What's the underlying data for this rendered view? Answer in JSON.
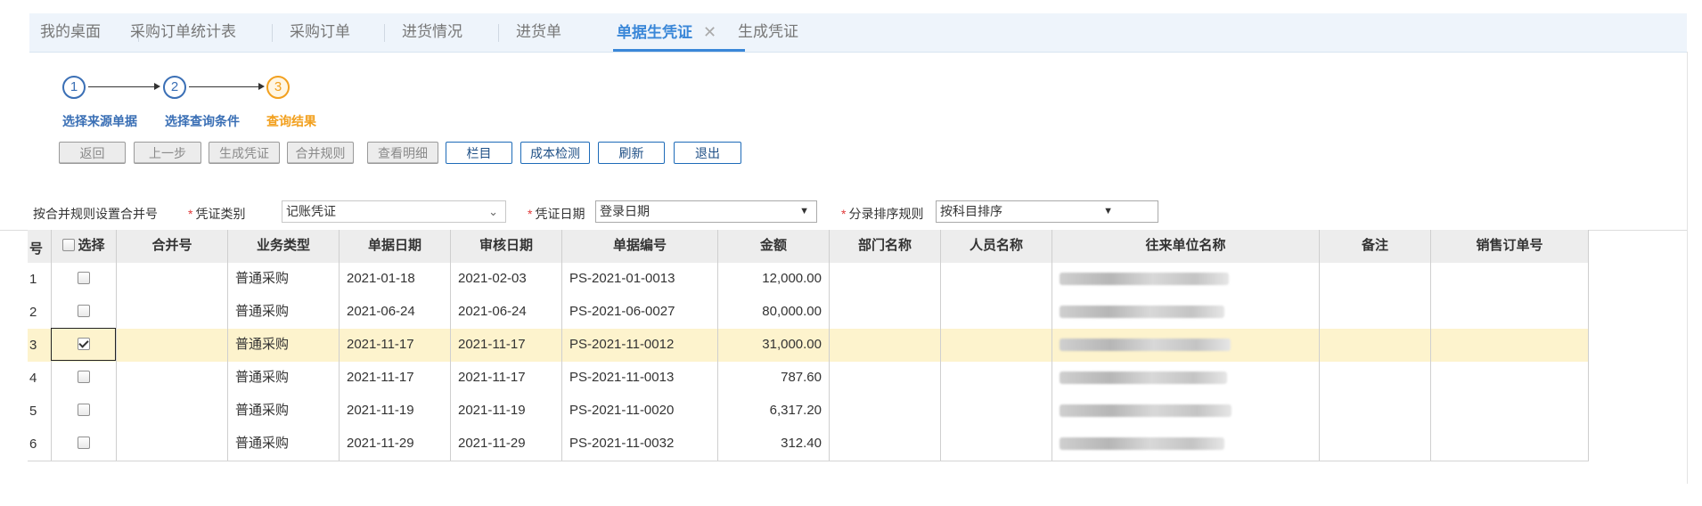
{
  "tabs": [
    {
      "label": "我的桌面",
      "active": false
    },
    {
      "label": "采购订单统计表",
      "active": false
    },
    {
      "label": "采购订单",
      "active": false
    },
    {
      "label": "进货情况",
      "active": false
    },
    {
      "label": "进货单",
      "active": false
    },
    {
      "label": "单据生凭证",
      "active": true,
      "closable": true
    },
    {
      "label": "生成凭证",
      "active": false
    }
  ],
  "tab_close_glyph": "✕",
  "steps": [
    {
      "number": "1",
      "label": "选择来源单据",
      "state": "done"
    },
    {
      "number": "2",
      "label": "选择查询条件",
      "state": "done"
    },
    {
      "number": "3",
      "label": "查询结果",
      "state": "current"
    }
  ],
  "toolbar": {
    "back": "返回",
    "prev_step": "上一步",
    "generate_voucher": "生成凭证",
    "merge_rules": "合并规则",
    "view_detail": "查看明细",
    "columns": "栏目",
    "cost_check": "成本检测",
    "refresh": "刷新",
    "exit": "退出"
  },
  "filters": {
    "merge_by_rule_label": "按合并规则设置合并号",
    "voucher_type_label": "凭证类别",
    "voucher_type_value": "记账凭证",
    "voucher_date_label": "凭证日期",
    "voucher_date_value": "登录日期",
    "sort_rule_label": "分录排序规则",
    "sort_rule_value": "按科目排序"
  },
  "table": {
    "headers": {
      "index": "号",
      "select": "选择",
      "merge_no": "合并号",
      "business_type": "业务类型",
      "doc_date": "单据日期",
      "audit_date": "审核日期",
      "doc_no": "单据编号",
      "amount": "金额",
      "dept": "部门名称",
      "person": "人员名称",
      "partner": "往来单位名称",
      "remark": "备注",
      "sales_order": "销售订单号"
    },
    "rows": [
      {
        "index": "1",
        "checked": false,
        "merge_no": "",
        "business_type": "普通采购",
        "doc_date": "2021-01-18",
        "audit_date": "2021-02-03",
        "doc_no": "PS-2021-01-0013",
        "amount": "12,000.00",
        "dept": "",
        "person": "",
        "partner_redacted": true,
        "remark": "",
        "sales_order": ""
      },
      {
        "index": "2",
        "checked": false,
        "merge_no": "",
        "business_type": "普通采购",
        "doc_date": "2021-06-24",
        "audit_date": "2021-06-24",
        "doc_no": "PS-2021-06-0027",
        "amount": "80,000.00",
        "dept": "",
        "person": "",
        "partner_redacted": true,
        "remark": "",
        "sales_order": ""
      },
      {
        "index": "3",
        "checked": true,
        "merge_no": "",
        "business_type": "普通采购",
        "doc_date": "2021-11-17",
        "audit_date": "2021-11-17",
        "doc_no": "PS-2021-11-0012",
        "amount": "31,000.00",
        "dept": "",
        "person": "",
        "partner_redacted": true,
        "remark": "",
        "sales_order": ""
      },
      {
        "index": "4",
        "checked": false,
        "merge_no": "",
        "business_type": "普通采购",
        "doc_date": "2021-11-17",
        "audit_date": "2021-11-17",
        "doc_no": "PS-2021-11-0013",
        "amount": "787.60",
        "dept": "",
        "person": "",
        "partner_redacted": true,
        "remark": "",
        "sales_order": ""
      },
      {
        "index": "5",
        "checked": false,
        "merge_no": "",
        "business_type": "普通采购",
        "doc_date": "2021-11-19",
        "audit_date": "2021-11-19",
        "doc_no": "PS-2021-11-0020",
        "amount": "6,317.20",
        "dept": "",
        "person": "",
        "partner_redacted": true,
        "remark": "",
        "sales_order": ""
      },
      {
        "index": "6",
        "checked": false,
        "merge_no": "",
        "business_type": "普通采购",
        "doc_date": "2021-11-29",
        "audit_date": "2021-11-29",
        "doc_no": "PS-2021-11-0032",
        "amount": "312.40",
        "dept": "",
        "person": "",
        "partner_redacted": true,
        "remark": "",
        "sales_order": ""
      }
    ]
  },
  "colors": {
    "accent": "#3a87d8",
    "step_done": "#3a6fb5",
    "step_current": "#f2a01e",
    "selected_row": "#fdf3cd",
    "required_mark": "#e03b3b"
  },
  "icons": {
    "tab_close": "close-icon",
    "select_caret": "chevron-down-icon",
    "step_arrow": "arrow-right-icon"
  }
}
